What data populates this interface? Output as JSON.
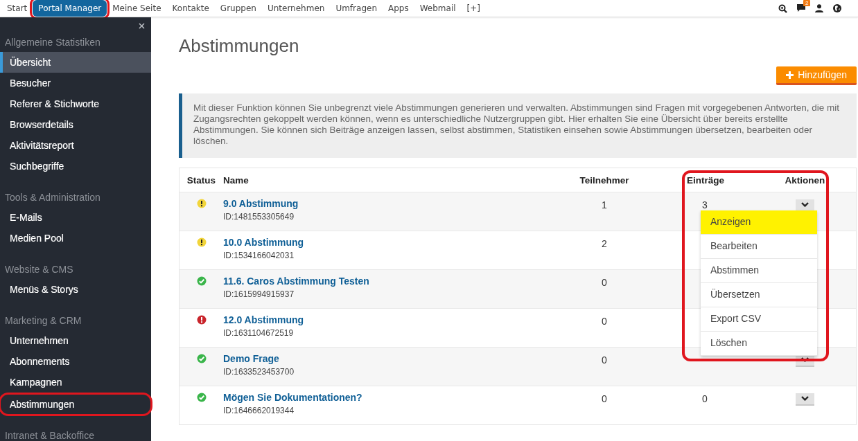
{
  "top_nav": [
    {
      "label": "Start",
      "selected": false,
      "highlighted": false
    },
    {
      "label": "Portal Manager",
      "selected": true,
      "highlighted": true
    },
    {
      "label": "Meine Seite",
      "selected": false,
      "highlighted": false
    },
    {
      "label": "Kontakte",
      "selected": false,
      "highlighted": false
    },
    {
      "label": "Gruppen",
      "selected": false,
      "highlighted": false
    },
    {
      "label": "Unternehmen",
      "selected": false,
      "highlighted": false
    },
    {
      "label": "Umfragen",
      "selected": false,
      "highlighted": false
    },
    {
      "label": "Apps",
      "selected": false,
      "highlighted": false
    },
    {
      "label": "Webmail",
      "selected": false,
      "highlighted": false
    },
    {
      "label": "[+]",
      "selected": false,
      "highlighted": false
    }
  ],
  "top_icons": {
    "messages_badge": "2"
  },
  "sidebar": {
    "sections": [
      {
        "title": "Allgemeine Statistiken",
        "items": [
          {
            "label": "Übersicht",
            "selected": true,
            "highlighted": false
          },
          {
            "label": "Besucher",
            "selected": false,
            "highlighted": false
          },
          {
            "label": "Referer & Stichworte",
            "selected": false,
            "highlighted": false
          },
          {
            "label": "Browserdetails",
            "selected": false,
            "highlighted": false
          },
          {
            "label": "Aktivitätsreport",
            "selected": false,
            "highlighted": false
          },
          {
            "label": "Suchbegriffe",
            "selected": false,
            "highlighted": false
          }
        ]
      },
      {
        "title": "Tools & Administration",
        "items": [
          {
            "label": "E-Mails",
            "selected": false,
            "highlighted": false
          },
          {
            "label": "Medien Pool",
            "selected": false,
            "highlighted": false
          }
        ]
      },
      {
        "title": "Website & CMS",
        "items": [
          {
            "label": "Menüs & Storys",
            "selected": false,
            "highlighted": false
          }
        ]
      },
      {
        "title": "Marketing & CRM",
        "items": [
          {
            "label": "Unternehmen",
            "selected": false,
            "highlighted": false
          },
          {
            "label": "Abonnements",
            "selected": false,
            "highlighted": false
          },
          {
            "label": "Kampagnen",
            "selected": false,
            "highlighted": false
          },
          {
            "label": "Abstimmungen",
            "selected": false,
            "highlighted": true
          }
        ]
      },
      {
        "title": "Intranet & Backoffice"
      }
    ]
  },
  "page": {
    "title": "Abstimmungen",
    "add_button": "Hinzufügen",
    "info": "Mit dieser Funktion können Sie unbegrenzt viele Abstimmungen generieren und verwalten. Abstimmungen sind Fragen mit vorgegebenen Antworten, die mit Zugangsrechten gekoppelt werden können, wenn es unterschiedliche Nutzergruppen gibt. Hier erhalten Sie eine Übersicht über bereits erstellte Abstimmungen. Sie können sich Beiträge anzeigen lassen, selbst abstimmen, Statistiken einsehen sowie Abstimmungen übersetzen, bearbeiten oder löschen."
  },
  "table": {
    "columns": [
      "Status",
      "Name",
      "Teilnehmer",
      "Einträge",
      "Aktionen"
    ],
    "rows": [
      {
        "kind": "warning",
        "name": "9.0 Abstimmung",
        "id": "ID:1481553305649",
        "participants": "1",
        "entries": "3"
      },
      {
        "kind": "warning",
        "name": "10.0 Abstimmung",
        "id": "ID:1534166042031",
        "participants": "2"
      },
      {
        "kind": "ok",
        "name": "11.6. Caros Abstimmung Testen",
        "id": "ID:1615994915937",
        "participants": "0"
      },
      {
        "kind": "error",
        "name": "12.0 Abstimmung",
        "id": "ID:1631104672519",
        "participants": "0"
      },
      {
        "kind": "ok",
        "name": "Demo Frage",
        "id": "ID:1633523453700",
        "participants": "0"
      },
      {
        "kind": "ok",
        "name": "Mögen Sie Dokumentationen?",
        "id": "ID:1646662019344",
        "participants": "0",
        "entries": "0"
      }
    ]
  },
  "action_menu": {
    "highlighted": true,
    "items": [
      {
        "label": "Anzeigen",
        "selected": true
      },
      {
        "label": "Bearbeiten",
        "selected": false
      },
      {
        "label": "Abstimmen",
        "selected": false
      },
      {
        "label": "Übersetzen",
        "selected": false
      },
      {
        "label": "Export CSV",
        "selected": false
      },
      {
        "label": "Löschen",
        "selected": false
      }
    ]
  }
}
